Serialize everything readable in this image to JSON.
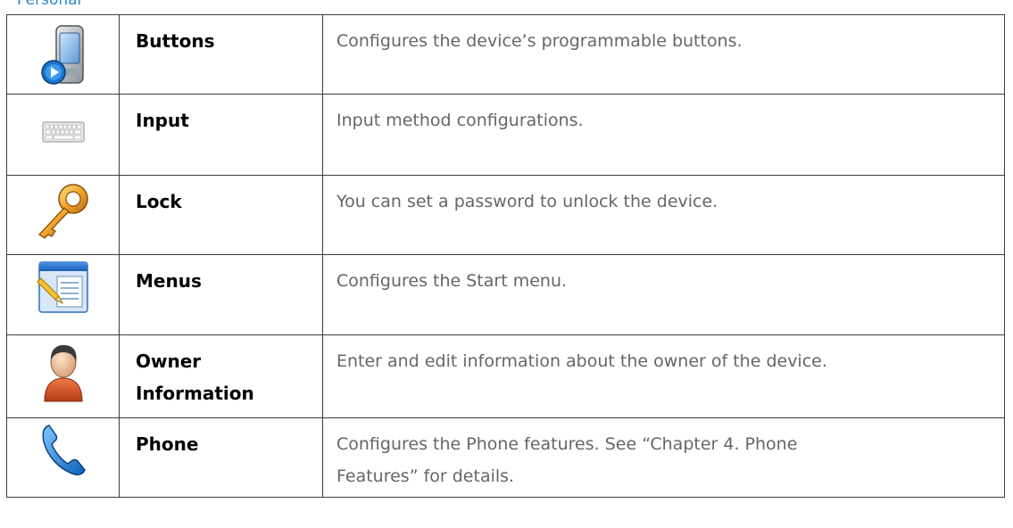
{
  "section_title": "Personal",
  "rows": [
    {
      "icon": "pda-device-button-icon",
      "name": "Buttons",
      "description": "Configures the device’s programmable buttons."
    },
    {
      "icon": "keyboard-icon",
      "name": "Input",
      "description": "Input method configurations."
    },
    {
      "icon": "key-icon",
      "name": "Lock",
      "description": "You can set a password to unlock the device."
    },
    {
      "icon": "start-menu-icon",
      "name": "Menus",
      "description": "Configures the Start menu."
    },
    {
      "icon": "person-icon",
      "name": "Owner Information",
      "description": "Enter and edit information about the owner of the device."
    },
    {
      "icon": "phone-handset-icon",
      "name": "Phone",
      "description": "Configures the Phone features. See “Chapter 4. Phone Features” for details."
    }
  ]
}
